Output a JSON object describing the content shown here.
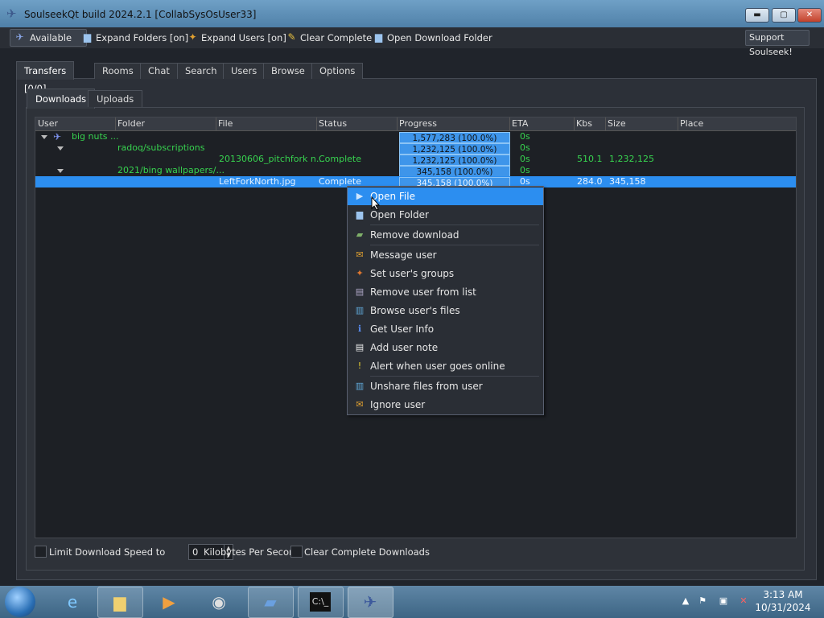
{
  "window": {
    "title": "SoulseekQt build 2024.2.1 [CollabSysOsUser33]"
  },
  "toolbar": {
    "available": "Available",
    "expand_folders": "Expand Folders [on]",
    "expand_users": "Expand Users [on]",
    "clear_complete": "Clear Complete",
    "open_download_folder": "Open Download Folder",
    "support": "Support Soulseek!"
  },
  "main_tabs": [
    "Transfers [0/0]",
    "Rooms",
    "Chat",
    "Search",
    "Users",
    "Browse",
    "Options"
  ],
  "sub_tabs": [
    "Downloads",
    "Uploads"
  ],
  "columns": [
    "User",
    "Folder",
    "File",
    "Status",
    "Progress",
    "ETA",
    "Kbs",
    "Size",
    "Place"
  ],
  "rows": [
    {
      "user": "big nuts ...",
      "folder": "",
      "file": "",
      "status": "",
      "progress": "1,577,283 (100.0%)",
      "eta": "0s",
      "kbs": "",
      "size": "",
      "progress_fraction": 1.0
    },
    {
      "user": "",
      "folder": "radoq/subscriptions",
      "file": "",
      "status": "",
      "progress": "1,232,125 (100.0%)",
      "eta": "0s",
      "kbs": "",
      "size": "",
      "progress_fraction": 1.0
    },
    {
      "user": "",
      "folder": "",
      "file": "20130606_pitchfork n...",
      "status": "Complete",
      "progress": "1,232,125 (100.0%)",
      "eta": "0s",
      "kbs": "510.1",
      "size": "1,232,125",
      "progress_fraction": 1.0
    },
    {
      "user": "",
      "folder": "2021/bing wallpapers/...",
      "file": "",
      "status": "",
      "progress": "345,158 (100.0%)",
      "eta": "0s",
      "kbs": "",
      "size": "",
      "progress_fraction": 1.0
    },
    {
      "user": "",
      "folder": "",
      "file": "LeftForkNorth.jpg",
      "status": "Complete",
      "progress": "345,158 (100.0%)",
      "eta": "0s",
      "kbs": "284.0",
      "size": "345,158",
      "progress_fraction": 1.0
    }
  ],
  "context_menu": [
    {
      "label": "Open File",
      "icon": "play-icon"
    },
    {
      "label": "Open Folder",
      "icon": "folder-icon"
    },
    {
      "label": "Remove download",
      "icon": "remove-download-icon"
    },
    {
      "label": "Message user",
      "icon": "message-icon"
    },
    {
      "label": "Set user's groups",
      "icon": "groups-icon"
    },
    {
      "label": "Remove user from list",
      "icon": "remove-user-icon"
    },
    {
      "label": "Browse user's files",
      "icon": "browse-icon"
    },
    {
      "label": "Get User Info",
      "icon": "info-icon"
    },
    {
      "label": "Add user note",
      "icon": "note-icon"
    },
    {
      "label": "Alert when user goes online",
      "icon": "alert-icon"
    },
    {
      "label": "Unshare files from user",
      "icon": "unshare-icon"
    },
    {
      "label": "Ignore user",
      "icon": "ignore-icon"
    }
  ],
  "bottom": {
    "limit_label": "Limit Download Speed to",
    "limit_value": "0",
    "unit_label": "Kilobytes Per Second",
    "clear_label": "Clear Complete Downloads"
  },
  "taskbar": {
    "time": "3:13 AM",
    "date": "10/31/2024"
  },
  "colors": {
    "accent": "#2c8ef0",
    "green_text": "#37d34f",
    "progress": "#3e95ea"
  }
}
